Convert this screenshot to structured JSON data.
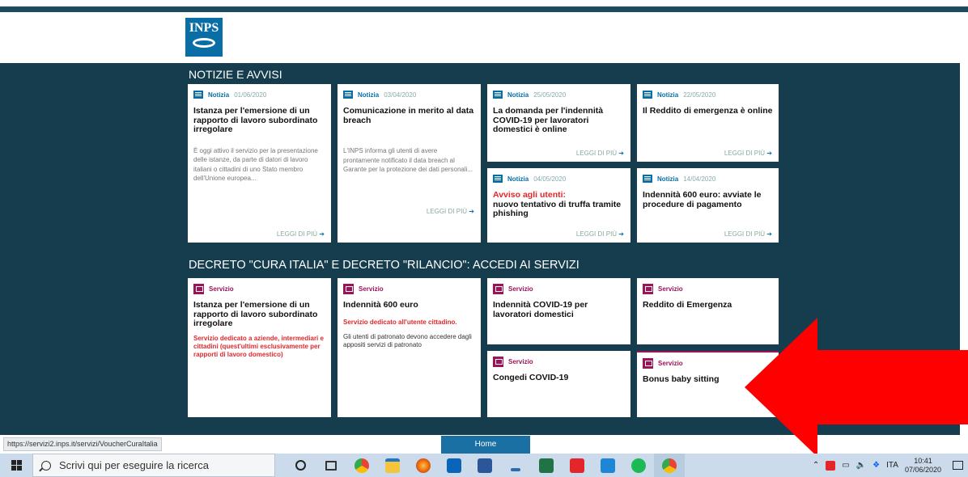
{
  "header": {
    "logo_text": "INPS"
  },
  "news": {
    "title": "NOTIZIE E AVVISI",
    "read_more": "LEGGI DI PIÙ",
    "cards": [
      {
        "tag": "Notizia",
        "date": "01/06/2020",
        "title": "Istanza per l'emersione di un rapporto di lavoro subordinato irregolare",
        "body": "È oggi attivo il servizio per la presentazione delle istanze, da parte di datori di lavoro italiani o cittadini di uno Stato membro dell'Unione europea..."
      },
      {
        "tag": "Notizia",
        "date": "03/04/2020",
        "title": "Comunicazione in merito al data breach",
        "body": "L'INPS informa gli utenti di avere prontamente notificato il data breach al Garante per la protezione dei dati personali..."
      },
      {
        "tag": "Notizia",
        "date": "25/05/2020",
        "title": "La domanda per l'indennità COVID-19 per lavoratori domestici è online"
      },
      {
        "tag": "Notizia",
        "date": "22/05/2020",
        "title": "Il Reddito di emergenza è online"
      },
      {
        "tag": "Notizia",
        "date": "04/05/2020",
        "alert": "Avviso agli utenti:",
        "title": "nuovo tentativo di truffa tramite phishing"
      },
      {
        "tag": "Notizia",
        "date": "14/04/2020",
        "title": "Indennità 600 euro: avviate le procedure di pagamento"
      }
    ]
  },
  "services": {
    "title": "DECRETO \"CURA ITALIA\" E DECRETO \"RILANCIO\": ACCEDI AI SERVIZI",
    "cards": [
      {
        "tag": "Servizio",
        "title": "Istanza per l'emersione di un rapporto di lavoro subordinato irregolare",
        "red": "Servizio dedicato a aziende, intermediari e cittadini (quest'ultimi esclusivamente per rapporti di lavoro domestico)"
      },
      {
        "tag": "Servizio",
        "title": "Indennità 600 euro",
        "red": "Servizio dedicato all'utente cittadino.",
        "note": "Gli utenti di patronato devono accedere dagli appositi servizi di patronato"
      },
      {
        "tag": "Servizio",
        "title": "Indennità COVID-19 per lavoratori domestici"
      },
      {
        "tag": "Servizio",
        "title": "Reddito di Emergenza"
      },
      {
        "tag": "Servizio",
        "title": "Congedi COVID-19"
      },
      {
        "tag": "Servizio",
        "title": "Bonus baby sitting"
      }
    ]
  },
  "footer": {
    "home_label": "Home"
  },
  "status_bar": {
    "url": "https://servizi2.inps.it/servizi/VoucherCuraItalia"
  },
  "taskbar": {
    "search_placeholder": "Scrivi qui per eseguire la ricerca",
    "language": "ITA",
    "time": "10:41",
    "date": "07/06/2020",
    "apps": [
      "cortana-icon",
      "task-view-icon",
      "chrome-icon",
      "file-explorer-icon",
      "firefox-icon",
      "outlook-icon",
      "word-icon",
      "app-icon",
      "excel-icon",
      "acrobat-icon",
      "paint-icon",
      "spotify-icon",
      "chrome-active-icon"
    ]
  },
  "colors": {
    "background": "#153d4e",
    "news_accent": "#0a6ea6",
    "service_accent": "#9b1458",
    "alert": "#e3262a",
    "arrow": "#ff0000"
  }
}
